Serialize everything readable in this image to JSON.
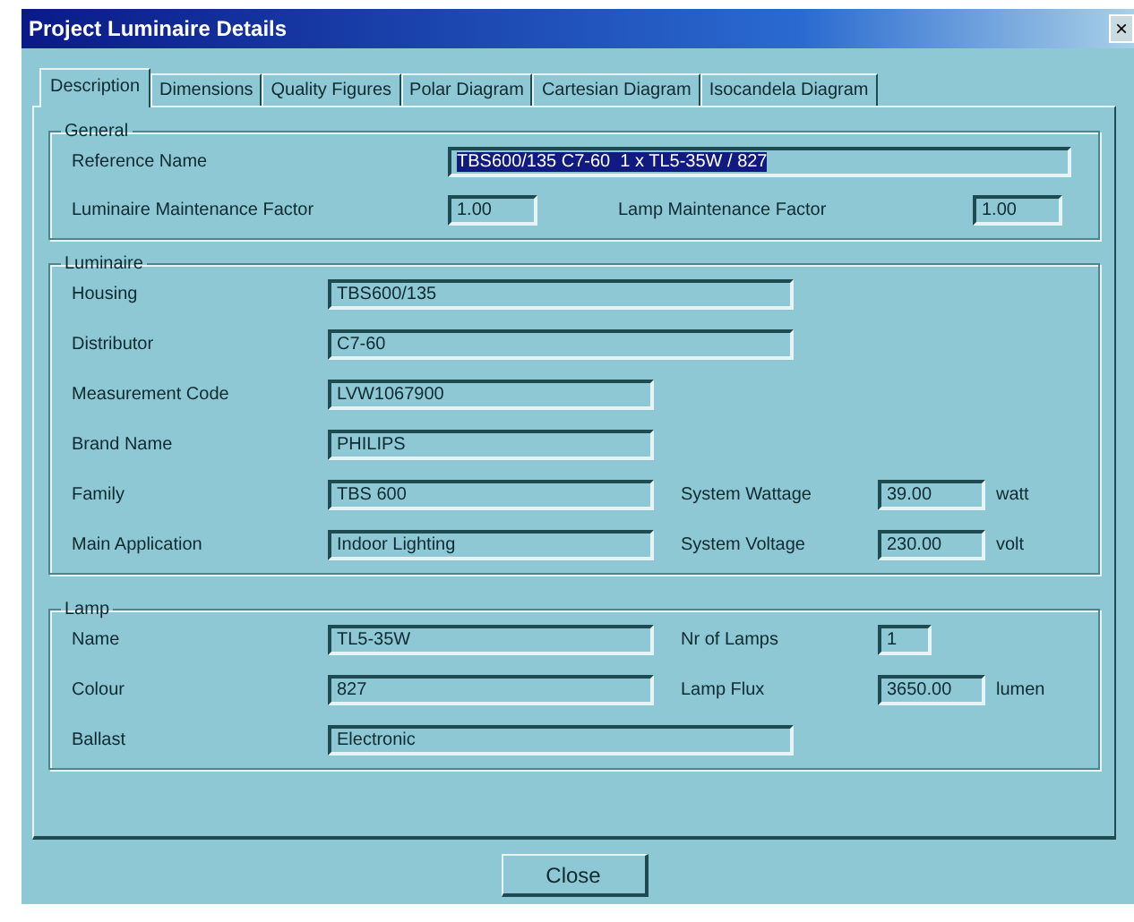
{
  "window": {
    "title": "Project Luminaire Details",
    "close": "×"
  },
  "tabs": [
    {
      "label": "Description",
      "selected": true
    },
    {
      "label": "Dimensions",
      "selected": false
    },
    {
      "label": "Quality Figures",
      "selected": false
    },
    {
      "label": "Polar Diagram",
      "selected": false
    },
    {
      "label": "Cartesian Diagram",
      "selected": false
    },
    {
      "label": "Isocandela Diagram",
      "selected": false
    }
  ],
  "general": {
    "title": "General",
    "reference": {
      "label": "Reference Name",
      "value": "TBS600/135 C7-60  1 x TL5-35W / 827",
      "selected": true
    },
    "factors": [
      {
        "label": "Luminaire Maintenance Factor",
        "value": "1.00"
      },
      {
        "label": "Lamp Maintenance Factor",
        "value": "1.00"
      }
    ]
  },
  "luminaire": {
    "title": "Luminaire",
    "rows": [
      {
        "label": "Housing",
        "value": "TBS600/135",
        "kind": "wide"
      },
      {
        "label": "Distributor",
        "value": "C7-60",
        "kind": "wide"
      },
      {
        "label": "Measurement Code",
        "value": "LVW1067900",
        "kind": "narrow"
      },
      {
        "label": "Brand Name",
        "value": "PHILIPS",
        "kind": "narrow"
      },
      {
        "label": "Family",
        "value": "TBS 600",
        "kind": "narrow",
        "extra": {
          "label": "System Wattage",
          "value": "39.00",
          "unit": "watt"
        }
      },
      {
        "label": "Main Application",
        "value": "Indoor Lighting",
        "kind": "narrow",
        "extra": {
          "label": "System Voltage",
          "value": "230.00",
          "unit": "volt"
        }
      }
    ]
  },
  "lamp": {
    "title": "Lamp",
    "rows": [
      {
        "label": "Name",
        "value": "TL5-35W",
        "kind": "narrow",
        "extra": {
          "label": "Nr of Lamps",
          "value": "1"
        }
      },
      {
        "label": "Colour",
        "value": "827",
        "kind": "narrow",
        "extra": {
          "label": "Lamp Flux",
          "value": "3650.00",
          "unit": "lumen"
        }
      },
      {
        "label": "Ballast",
        "value": "Electronic",
        "kind": "wide"
      }
    ]
  },
  "buttons": [
    "Close"
  ]
}
